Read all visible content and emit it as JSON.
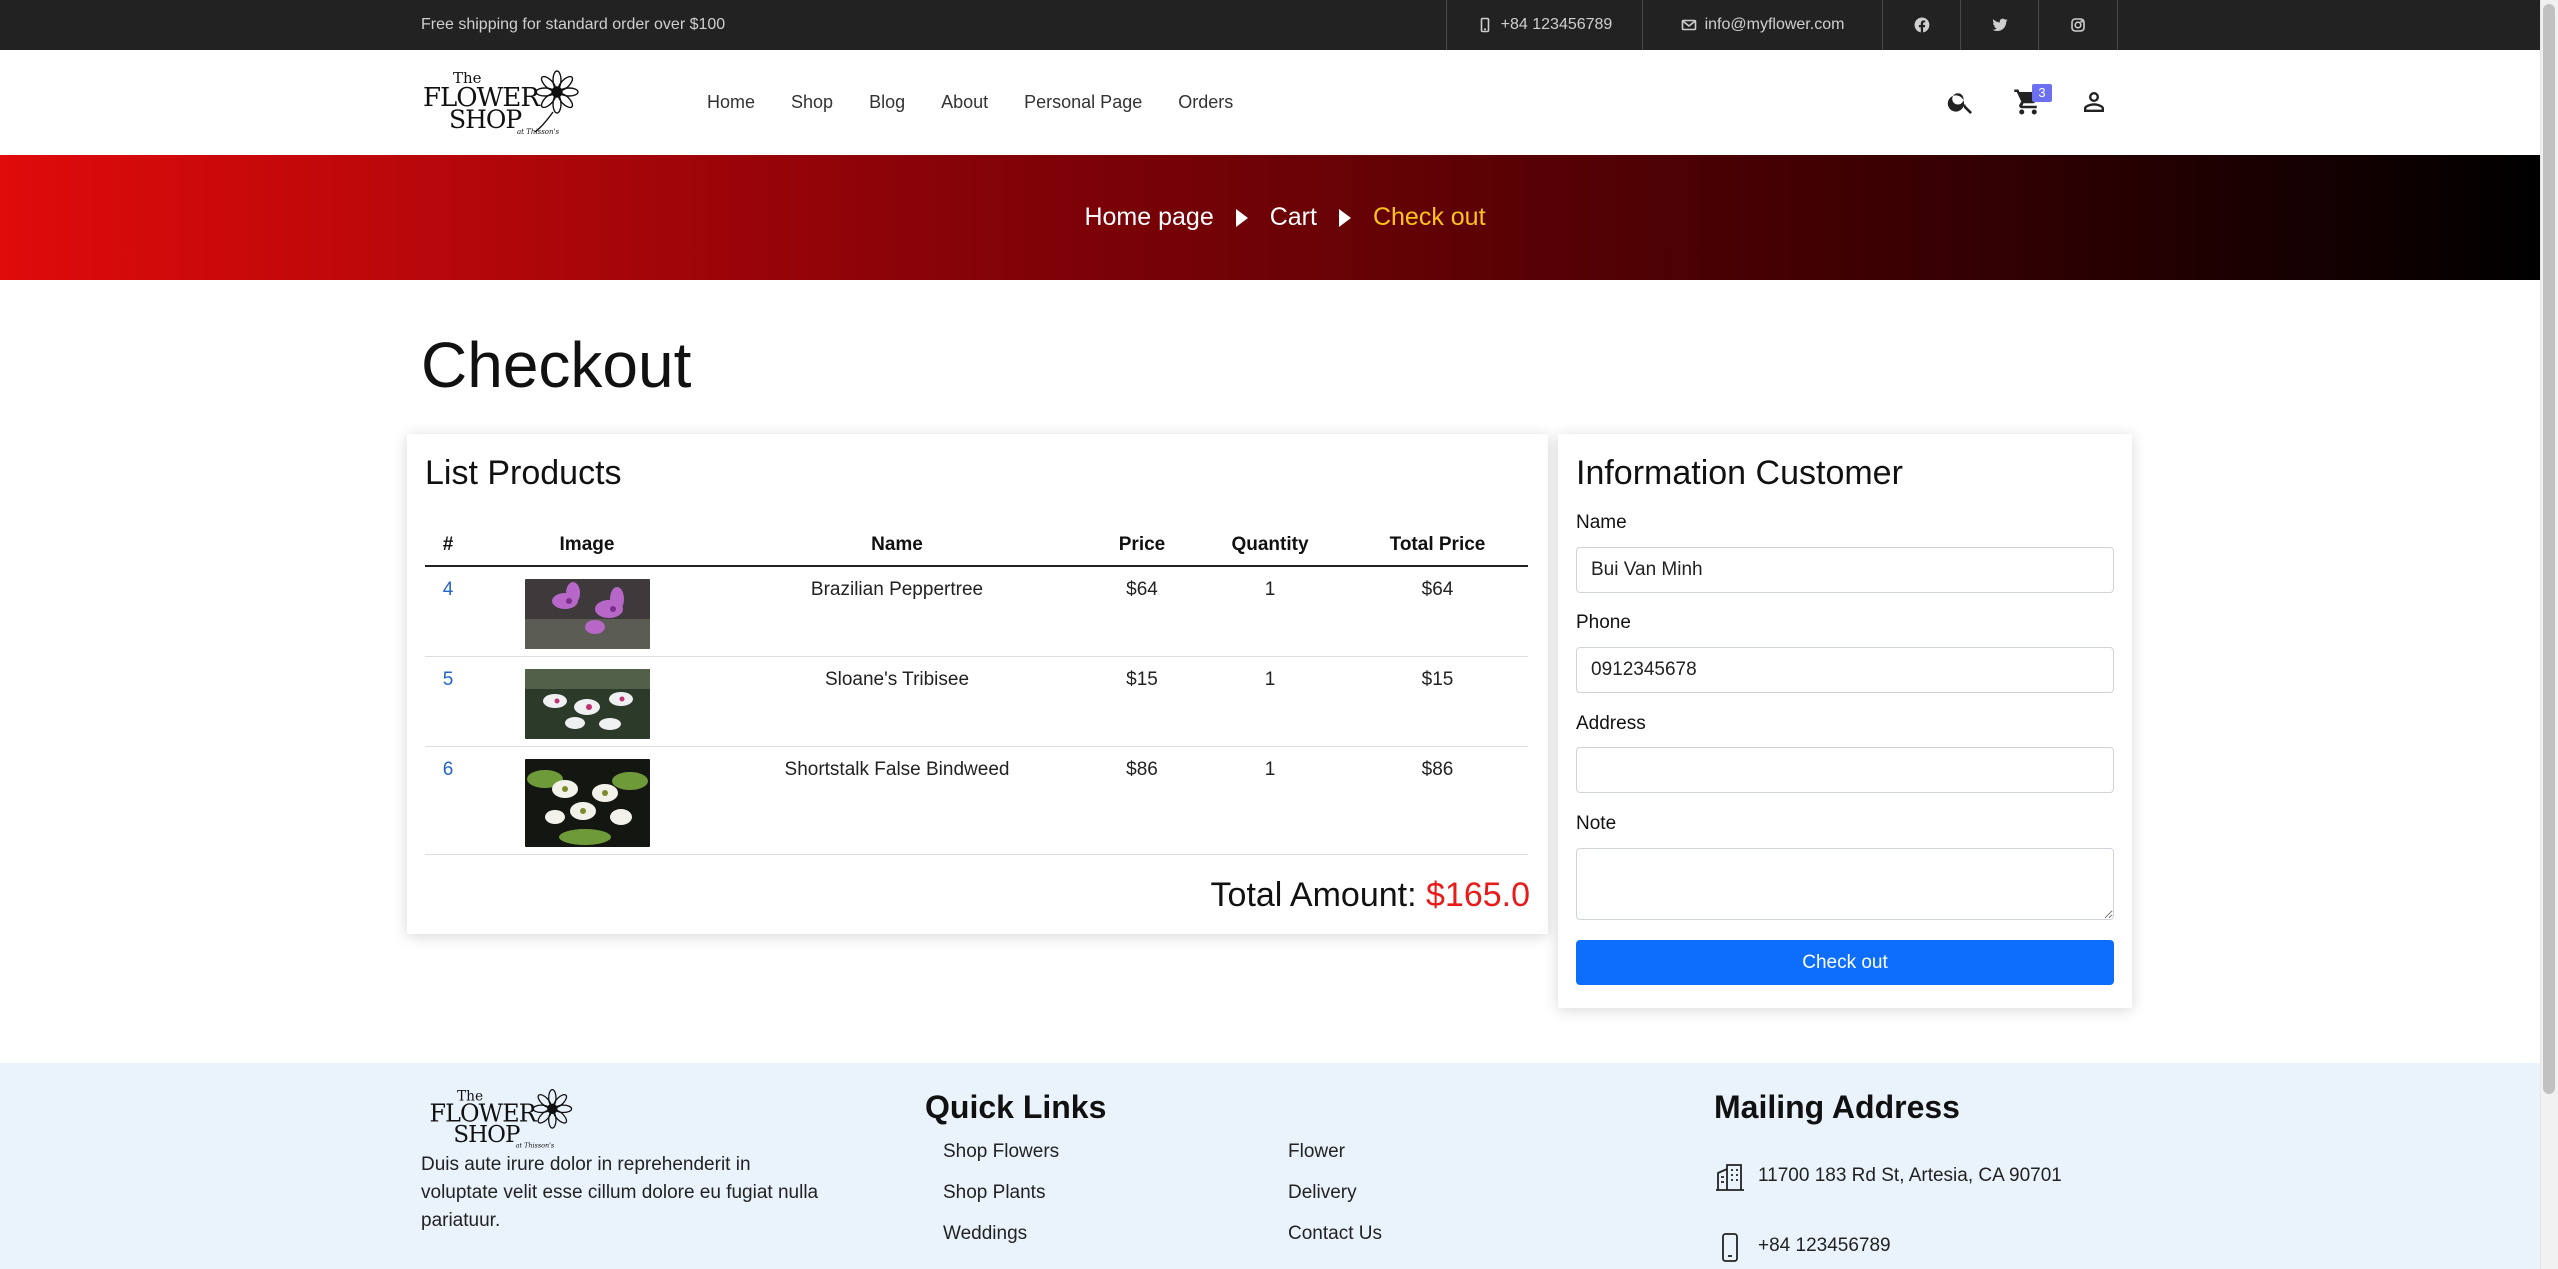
{
  "topbar": {
    "shipping": "Free shipping for standard order over $100",
    "phone": "+84 123456789",
    "email": "info@myflower.com"
  },
  "header": {
    "logo": {
      "line1": "The",
      "line2": "FLOWER",
      "line3": "SHOP",
      "line4": "at Thisson's"
    },
    "nav": [
      "Home",
      "Shop",
      "Blog",
      "About",
      "Personal Page",
      "Orders"
    ],
    "cart_count": "3"
  },
  "breadcrumb": {
    "home": "Home page",
    "cart": "Cart",
    "current": "Check out"
  },
  "page_title": "Checkout",
  "products": {
    "heading": "List Products",
    "columns": [
      "#",
      "Image",
      "Name",
      "Price",
      "Quantity",
      "Total Price"
    ],
    "rows": [
      {
        "id": "4",
        "name": "Brazilian Peppertree",
        "price": "$64",
        "qty": "1",
        "total": "$64"
      },
      {
        "id": "5",
        "name": "Sloane's Tribisee",
        "price": "$15",
        "qty": "1",
        "total": "$15"
      },
      {
        "id": "6",
        "name": "Shortstalk False Bindweed",
        "price": "$86",
        "qty": "1",
        "total": "$86"
      }
    ],
    "total_label": "Total Amount:",
    "total_value": "$165.0"
  },
  "customer": {
    "heading": "Information Customer",
    "name_label": "Name",
    "name_value": "Bui Van Minh",
    "phone_label": "Phone",
    "phone_value": "0912345678",
    "address_label": "Address",
    "address_value": "",
    "note_label": "Note",
    "note_value": "",
    "submit_label": "Check out"
  },
  "footer": {
    "description": "Duis aute irure dolor in reprehenderit in voluptate velit esse cillum dolore eu fugiat nulla pariatuur.",
    "quick_links_title": "Quick Links",
    "links_left": [
      "Shop Flowers",
      "Shop Plants",
      "Weddings"
    ],
    "links_right": [
      "Flower",
      "Delivery",
      "Contact Us"
    ],
    "mailing_title": "Mailing Address",
    "address": "11700 183 Rd St, Artesia, CA 90701",
    "phone": "+84 123456789"
  },
  "colors": {
    "accent": "#0d6efd",
    "total": "#e81b1b",
    "crumb_current": "#ffc31a",
    "topbar": "#222222"
  }
}
